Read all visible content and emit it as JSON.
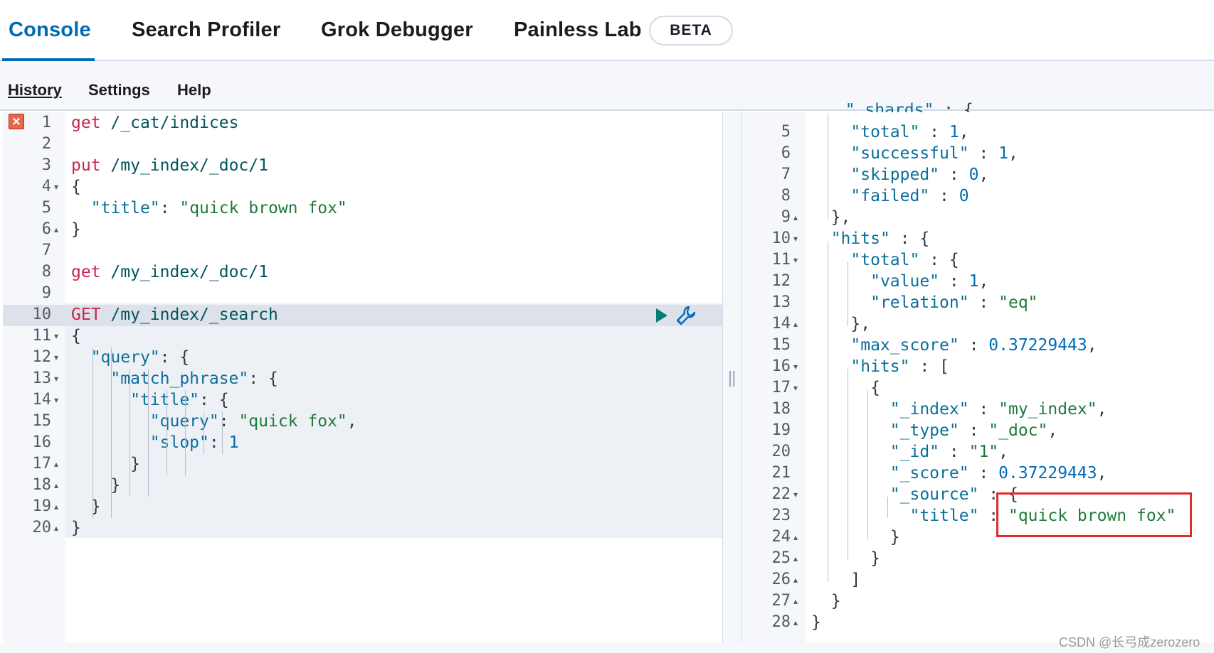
{
  "tabs": [
    {
      "label": "Console",
      "active": true
    },
    {
      "label": "Search Profiler",
      "active": false
    },
    {
      "label": "Grok Debugger",
      "active": false
    },
    {
      "label": "Painless Lab",
      "active": false
    }
  ],
  "beta_badge": "BETA",
  "submenu": {
    "history": "History",
    "settings": "Settings",
    "help": "Help"
  },
  "request_editor": {
    "lines": [
      {
        "n": "1",
        "text": "get /_cat/indices"
      },
      {
        "n": "2",
        "text": ""
      },
      {
        "n": "3",
        "text": "put /my_index/_doc/1"
      },
      {
        "n": "4",
        "text": "{",
        "fold": "down"
      },
      {
        "n": "5",
        "text": "  \"title\": \"quick brown fox\""
      },
      {
        "n": "6",
        "text": "}",
        "fold": "up"
      },
      {
        "n": "7",
        "text": ""
      },
      {
        "n": "8",
        "text": "get /my_index/_doc/1"
      },
      {
        "n": "9",
        "text": ""
      },
      {
        "n": "10",
        "text": "GET /my_index/_search"
      },
      {
        "n": "11",
        "text": "{",
        "fold": "down"
      },
      {
        "n": "12",
        "text": "  \"query\": {",
        "fold": "down"
      },
      {
        "n": "13",
        "text": "    \"match_phrase\": {",
        "fold": "down"
      },
      {
        "n": "14",
        "text": "      \"title\": {",
        "fold": "down"
      },
      {
        "n": "15",
        "text": "        \"query\": \"quick fox\","
      },
      {
        "n": "16",
        "text": "        \"slop\": 1"
      },
      {
        "n": "17",
        "text": "      }",
        "fold": "up"
      },
      {
        "n": "18",
        "text": "    }",
        "fold": "up"
      },
      {
        "n": "19",
        "text": "  }",
        "fold": "up"
      },
      {
        "n": "20",
        "text": "}",
        "fold": "up"
      }
    ]
  },
  "response_viewer": {
    "top_partial": "_shards",
    "lines": [
      {
        "n": "5",
        "text": "    \"total\" : 1,"
      },
      {
        "n": "6",
        "text": "    \"successful\" : 1,"
      },
      {
        "n": "7",
        "text": "    \"skipped\" : 0,"
      },
      {
        "n": "8",
        "text": "    \"failed\" : 0"
      },
      {
        "n": "9",
        "text": "  },",
        "fold": "up"
      },
      {
        "n": "10",
        "text": "  \"hits\" : {",
        "fold": "down"
      },
      {
        "n": "11",
        "text": "    \"total\" : {",
        "fold": "down"
      },
      {
        "n": "12",
        "text": "      \"value\" : 1,"
      },
      {
        "n": "13",
        "text": "      \"relation\" : \"eq\""
      },
      {
        "n": "14",
        "text": "    },",
        "fold": "up"
      },
      {
        "n": "15",
        "text": "    \"max_score\" : 0.37229443,"
      },
      {
        "n": "16",
        "text": "    \"hits\" : [",
        "fold": "down"
      },
      {
        "n": "17",
        "text": "      {",
        "fold": "down"
      },
      {
        "n": "18",
        "text": "        \"_index\" : \"my_index\","
      },
      {
        "n": "19",
        "text": "        \"_type\" : \"_doc\","
      },
      {
        "n": "20",
        "text": "        \"_id\" : \"1\","
      },
      {
        "n": "21",
        "text": "        \"_score\" : 0.37229443,"
      },
      {
        "n": "22",
        "text": "        \"_source\" : {",
        "fold": "down"
      },
      {
        "n": "23",
        "text": "          \"title\" : \"quick brown fox\""
      },
      {
        "n": "24",
        "text": "        }",
        "fold": "up"
      },
      {
        "n": "25",
        "text": "      }",
        "fold": "up"
      },
      {
        "n": "26",
        "text": "    ]",
        "fold": "up"
      },
      {
        "n": "27",
        "text": "  }",
        "fold": "up"
      },
      {
        "n": "28",
        "text": "}",
        "fold": "up"
      }
    ]
  },
  "watermark": "CSDN @长弓成zerozero",
  "colors": {
    "accent": "#006bb4",
    "method": "#c7254e",
    "string": "#1f7a3a",
    "key": "#0b6e99",
    "highlight": "#e5292b"
  },
  "icons": [
    "error-icon",
    "play-icon",
    "wrench-icon",
    "resizer-icon"
  ]
}
